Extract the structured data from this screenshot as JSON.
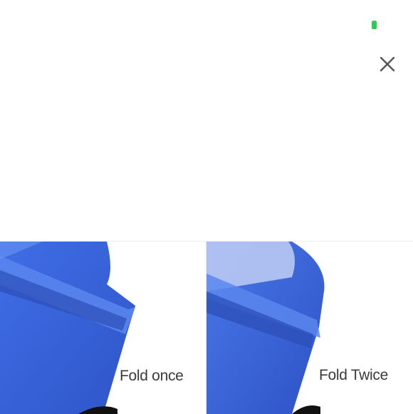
{
  "status": {
    "indicator_color": "#2ecc55"
  },
  "toolbar": {
    "close_icon": "close-icon"
  },
  "gallery": {
    "panels": [
      {
        "caption": "Fold once"
      },
      {
        "caption": "Fold Twice"
      }
    ],
    "accent": "#3a63d8"
  }
}
